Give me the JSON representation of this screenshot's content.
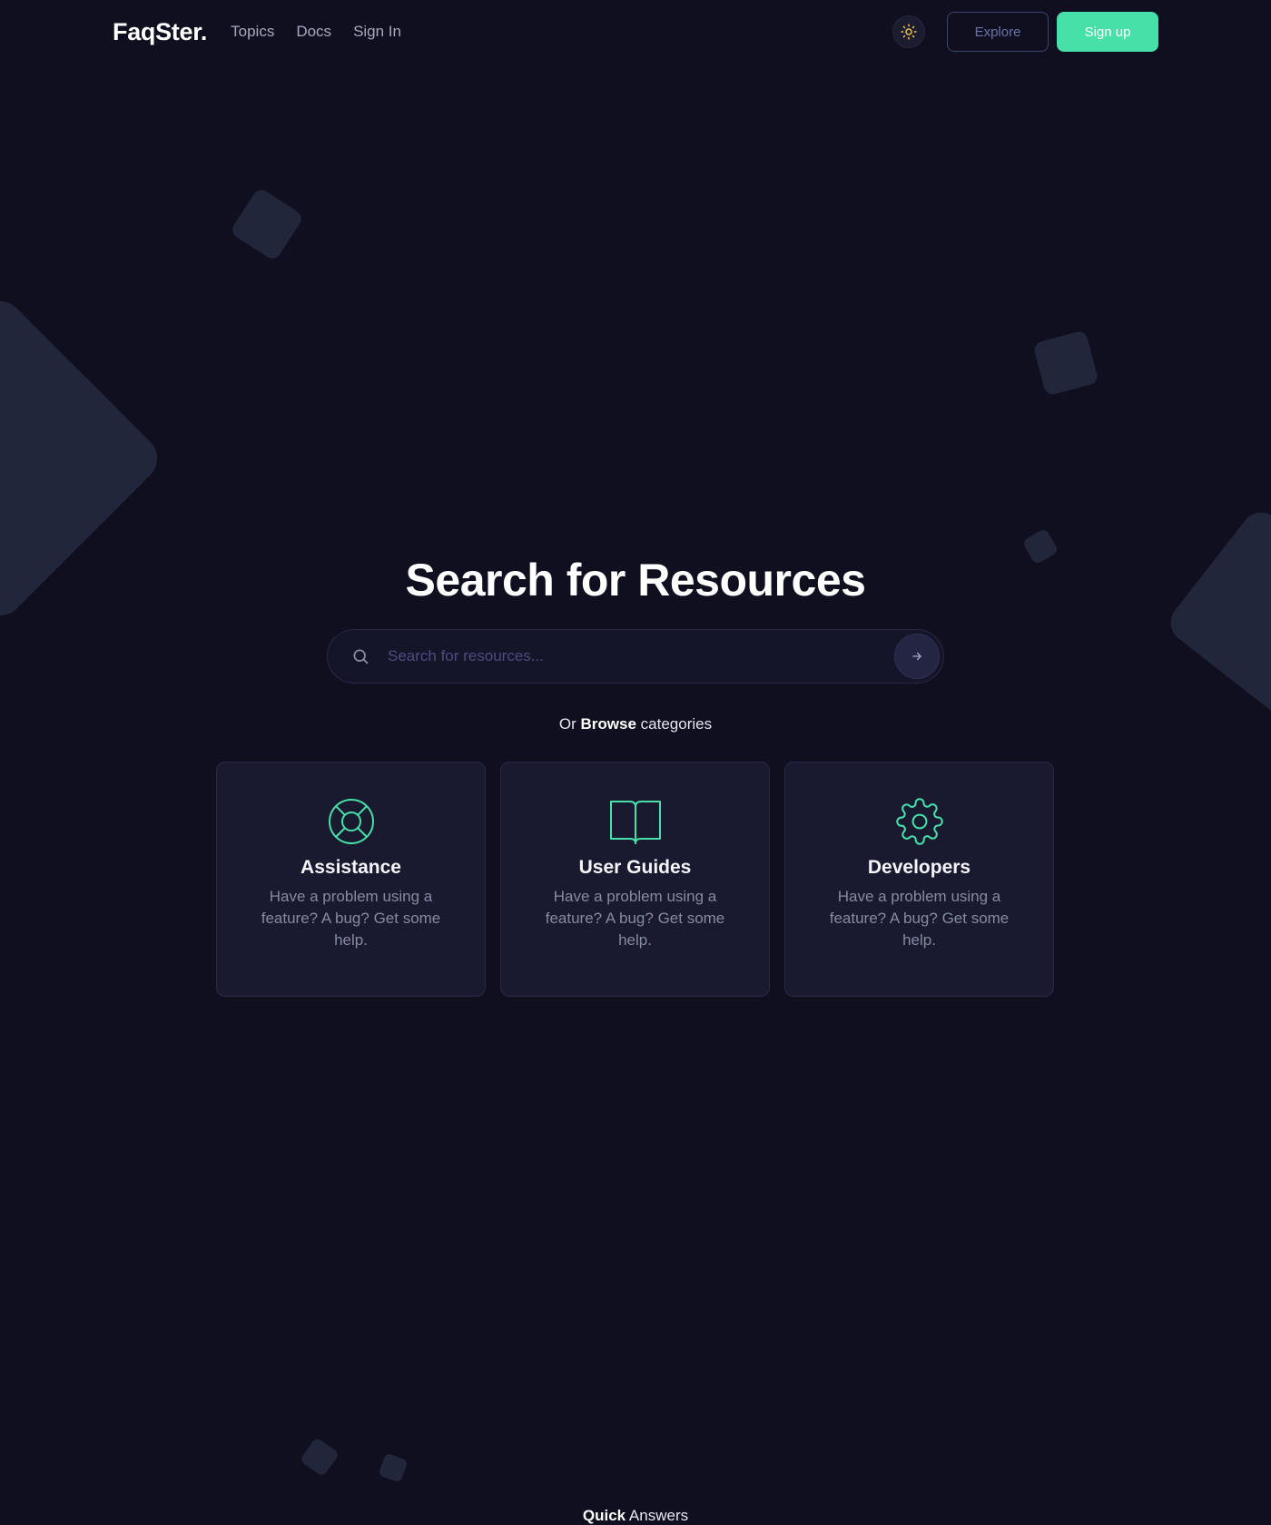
{
  "header": {
    "logo": "FaqSter.",
    "nav": [
      {
        "label": "Topics"
      },
      {
        "label": "Docs"
      },
      {
        "label": "Sign In"
      }
    ],
    "theme_toggle_icon": "sun-icon",
    "explore_label": "Explore",
    "signup_label": "Sign up"
  },
  "hero": {
    "title": "Search for Resources",
    "search": {
      "placeholder": "Search for resources...",
      "value": "",
      "search_icon": "search-icon",
      "submit_icon": "arrow-right-icon"
    },
    "browse": {
      "prefix": "Or",
      "bold": "Browse",
      "suffix": "categories"
    }
  },
  "categories": [
    {
      "icon": "lifebuoy-icon",
      "title": "Assistance",
      "description": "Have a problem using a feature? A bug? Get some help."
    },
    {
      "icon": "book-open-icon",
      "title": "User Guides",
      "description": "Have a problem using a feature? A bug? Get some help."
    },
    {
      "icon": "gear-icon",
      "title": "Developers",
      "description": "Have a problem using a feature? A bug? Get some help."
    }
  ],
  "quick_answers": {
    "bold": "Quick",
    "rest": "Answers"
  },
  "colors": {
    "background": "#0f0f1f",
    "accent": "#48e0a9",
    "card": "#191a30",
    "sun": "#f2c14e"
  }
}
